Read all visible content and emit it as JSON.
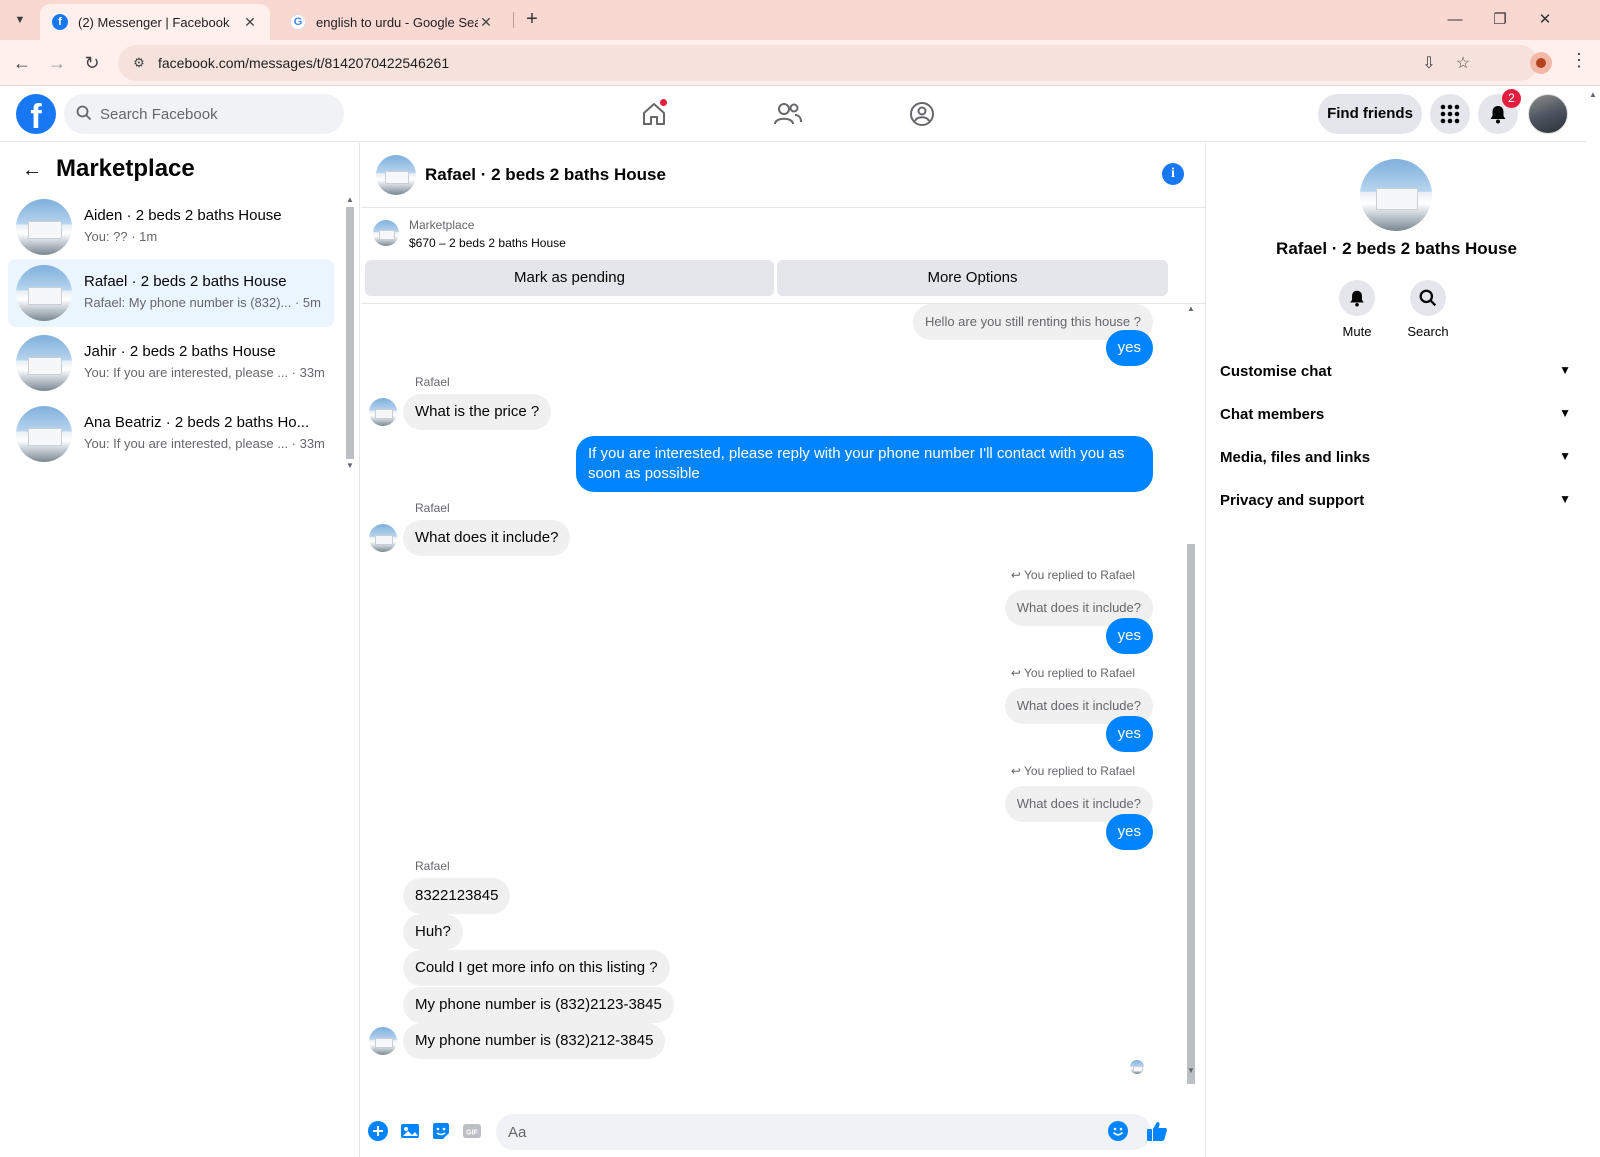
{
  "browser": {
    "tabs": [
      {
        "title": "(2) Messenger | Facebook",
        "active": true,
        "favicon": "facebook-favicon"
      },
      {
        "title": "english to urdu - Google Search",
        "active": false,
        "favicon": "google-favicon"
      }
    ],
    "url": "facebook.com/messages/t/8142070422546261"
  },
  "fb_header": {
    "search_placeholder": "Search Facebook",
    "find_friends_label": "Find friends",
    "notification_count": "2"
  },
  "left_panel": {
    "title": "Marketplace",
    "conversations": [
      {
        "name": "Aiden · 2 beds 2 baths House",
        "preview": "You: ?? · 1m",
        "selected": false
      },
      {
        "name": "Rafael · 2 beds 2 baths House",
        "preview": "Rafael: My phone number is (832)... · 5m",
        "selected": true
      },
      {
        "name": "Jahir · 2 beds 2 baths House",
        "preview": "You: If you are interested, please ... · 33m",
        "selected": false
      },
      {
        "name": "Ana Beatriz · 2 beds 2 baths Ho...",
        "preview": "You: If you are interested, please ... · 33m",
        "selected": false
      }
    ]
  },
  "chat": {
    "title": "Rafael · 2 beds 2 baths House",
    "listing": {
      "source": "Marketplace",
      "price_line": "$670 – 2 beds 2 baths House",
      "mark_pending_label": "Mark as pending",
      "more_options_label": "More Options"
    },
    "messages": {
      "m1": "Hello are you still renting this house ?",
      "m2": "yes",
      "sender1": "Rafael",
      "m3": "What is the price ?",
      "m4a": "If you are interested, please reply with your phone number  I'll contact with you as",
      "m4b": "soon as possible",
      "sender2": "Rafael",
      "m5": "What does it include?",
      "replied_label": "You replied to Rafael",
      "quoted": "What does it include?",
      "yes": "yes",
      "sender3": "Rafael",
      "m6": "8322123845",
      "m7": "Huh?",
      "m8": "Could I get more info on this listing ?",
      "m9": "My phone number is (832)2123-3845",
      "m10": "My phone number is (832)212-3845"
    },
    "composer_placeholder": "Aa"
  },
  "right_panel": {
    "name": "Rafael · 2 beds 2 baths House",
    "mute_label": "Mute",
    "search_label": "Search",
    "sections": [
      "Customise chat",
      "Chat members",
      "Media, files and links",
      "Privacy and support"
    ]
  },
  "colors": {
    "brand_blue": "#1877f2",
    "outgoing_bubble": "#0084ff",
    "incoming_bubble": "#f0f0f0",
    "tabstrip": "#f9d8d2",
    "badge_red": "#e41e3f"
  }
}
